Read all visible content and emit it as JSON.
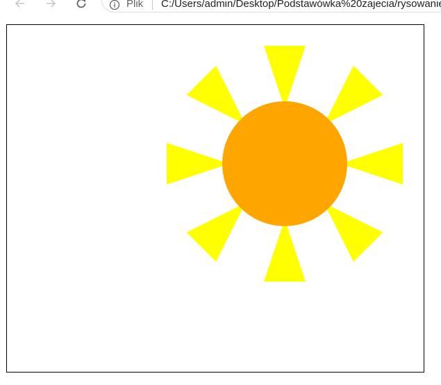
{
  "browser": {
    "site_info_label": "Plik",
    "url": "C:/Users/admin/Desktop/Podstawówka%20zajecia/rysowanie"
  },
  "drawing": {
    "sun_color": "#FFA500",
    "ray_color": "#FFFF00",
    "ray_count": 8,
    "border_color": "#000000"
  }
}
